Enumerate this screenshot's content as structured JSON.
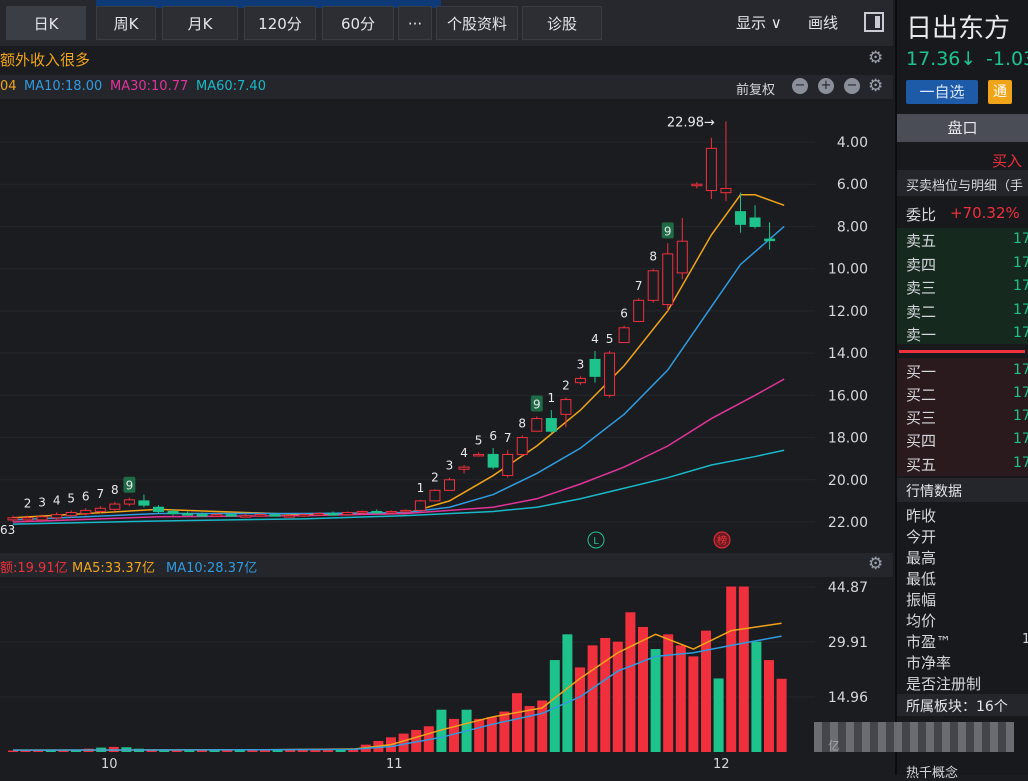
{
  "toolbar": {
    "tabs": [
      "日K",
      "周K",
      "月K",
      "120分",
      "60分"
    ],
    "more_label": "···",
    "profile_label": "个股资料",
    "diagnose_label": "诊股",
    "display_label": "显示 ∨",
    "draw_label": "画线"
  },
  "news_headline": "额外收入很多",
  "ma": {
    "ma5": "04",
    "ma10": "MA10:18.00",
    "ma30": "MA30:10.77",
    "ma60": "MA60:7.40",
    "adjust_label": "前复权",
    "color_ma5": "#f0a419",
    "color_ma10": "#2f9be0",
    "color_ma30": "#e0349a",
    "color_ma60": "#19b8c8"
  },
  "volume_header": {
    "amount": "额:19.91亿",
    "ma5": "MA5:33.37亿",
    "ma10": "MA10:28.37亿"
  },
  "price_axis": [
    "22.00",
    "20.00",
    "18.00",
    "16.00",
    "14.00",
    "12.00",
    "10.00",
    "8.00",
    "6.00",
    "4.00"
  ],
  "volume_axis": [
    "44.87",
    "29.91",
    "14.96"
  ],
  "volume_unit": "亿",
  "max_marker": "22.98→",
  "min_marker": "63",
  "date_labels": [
    "10",
    "11",
    "12"
  ],
  "markers": {
    "l": "L",
    "bang": "榜"
  },
  "stock": {
    "name": "日出东方",
    "price": "17.36↓",
    "change": "-1.03",
    "add_watch": "一自选",
    "tong": "通",
    "pankou": "盘口",
    "buy_in": "买入",
    "order_book_title": "买卖档位与明细（手",
    "weibi_label": "委比",
    "weibi_value": "+70.32%",
    "asks": [
      "卖五",
      "卖四",
      "卖三",
      "卖二",
      "卖一"
    ],
    "bids": [
      "买一",
      "买二",
      "买三",
      "买四",
      "买五"
    ],
    "level_value": "17",
    "market_title": "行情数据",
    "market_fields": [
      "昨收",
      "今开",
      "最高",
      "最低",
      "振幅",
      "均价",
      "市盈™",
      "市净率",
      "是否注册制"
    ],
    "pe_value": "1",
    "sector_label": "所属板块：16个",
    "bottom_cut": "热千概念"
  },
  "colors": {
    "up": "#f0303c",
    "down": "#1ec38b",
    "accent": "#f0a419",
    "watch": "#2f7fd9"
  },
  "chart_data": [
    {
      "type": "candlestick",
      "title": "日K",
      "ylim": [
        3.5,
        23.5
      ],
      "yticks": [
        4,
        6,
        8,
        10,
        12,
        14,
        16,
        18,
        20,
        22
      ],
      "max_label": 22.98,
      "candles": [
        {
          "o": 4.1,
          "c": 4.2,
          "h": 4.3,
          "l": 4.0
        },
        {
          "o": 4.1,
          "c": 4.2,
          "h": 4.3,
          "l": 4.0
        },
        {
          "o": 4.1,
          "c": 4.25,
          "h": 4.35,
          "l": 4.05
        },
        {
          "o": 4.2,
          "c": 4.35,
          "h": 4.45,
          "l": 4.1
        },
        {
          "o": 4.3,
          "c": 4.45,
          "h": 4.55,
          "l": 4.2
        },
        {
          "o": 4.4,
          "c": 4.55,
          "h": 4.65,
          "l": 4.3
        },
        {
          "o": 4.5,
          "c": 4.65,
          "h": 4.75,
          "l": 4.4
        },
        {
          "o": 4.6,
          "c": 4.85,
          "h": 4.95,
          "l": 4.5
        },
        {
          "o": 4.85,
          "c": 5.05,
          "h": 5.15,
          "l": 4.75
        },
        {
          "o": 5.0,
          "c": 4.8,
          "h": 5.3,
          "l": 4.7
        },
        {
          "o": 4.7,
          "c": 4.5,
          "h": 4.8,
          "l": 4.4
        },
        {
          "o": 4.5,
          "c": 4.4,
          "h": 4.6,
          "l": 4.3
        },
        {
          "o": 4.4,
          "c": 4.35,
          "h": 4.5,
          "l": 4.3
        },
        {
          "o": 4.35,
          "c": 4.3,
          "h": 4.45,
          "l": 4.25
        },
        {
          "o": 4.3,
          "c": 4.35,
          "h": 4.4,
          "l": 4.25
        },
        {
          "o": 4.35,
          "c": 4.3,
          "h": 4.4,
          "l": 4.25
        },
        {
          "o": 4.3,
          "c": 4.3,
          "h": 4.4,
          "l": 4.25
        },
        {
          "o": 4.3,
          "c": 4.35,
          "h": 4.4,
          "l": 4.25
        },
        {
          "o": 4.35,
          "c": 4.3,
          "h": 4.4,
          "l": 4.25
        },
        {
          "o": 4.3,
          "c": 4.3,
          "h": 4.35,
          "l": 4.25
        },
        {
          "o": 4.3,
          "c": 4.35,
          "h": 4.4,
          "l": 4.25
        },
        {
          "o": 4.35,
          "c": 4.4,
          "h": 4.45,
          "l": 4.3
        },
        {
          "o": 4.4,
          "c": 4.35,
          "h": 4.5,
          "l": 4.3
        },
        {
          "o": 4.35,
          "c": 4.45,
          "h": 4.5,
          "l": 4.3
        },
        {
          "o": 4.45,
          "c": 4.5,
          "h": 4.55,
          "l": 4.4
        },
        {
          "o": 4.5,
          "c": 4.45,
          "h": 4.6,
          "l": 4.4
        },
        {
          "o": 4.45,
          "c": 4.5,
          "h": 4.55,
          "l": 4.4
        },
        {
          "o": 4.5,
          "c": 4.55,
          "h": 4.6,
          "l": 4.45
        },
        {
          "o": 4.55,
          "c": 5.0,
          "h": 5.05,
          "l": 4.55
        },
        {
          "o": 5.0,
          "c": 5.5,
          "h": 5.55,
          "l": 5.0
        },
        {
          "o": 5.5,
          "c": 6.0,
          "h": 6.1,
          "l": 5.5
        },
        {
          "o": 6.5,
          "c": 6.6,
          "h": 6.7,
          "l": 6.3
        },
        {
          "o": 7.2,
          "c": 7.2,
          "h": 7.3,
          "l": 7.1
        },
        {
          "o": 7.2,
          "c": 6.6,
          "h": 7.5,
          "l": 6.5
        },
        {
          "o": 6.2,
          "c": 7.2,
          "h": 7.4,
          "l": 6.1
        },
        {
          "o": 7.2,
          "c": 8.0,
          "h": 8.1,
          "l": 7.1
        },
        {
          "o": 8.3,
          "c": 8.9,
          "h": 9.0,
          "l": 8.3
        },
        {
          "o": 8.9,
          "c": 8.3,
          "h": 9.3,
          "l": 8.2
        },
        {
          "o": 9.1,
          "c": 9.8,
          "h": 9.9,
          "l": 8.5
        },
        {
          "o": 10.6,
          "c": 10.8,
          "h": 10.9,
          "l": 10.5
        },
        {
          "o": 11.7,
          "c": 10.9,
          "h": 12.1,
          "l": 10.6
        },
        {
          "o": 10.0,
          "c": 12.0,
          "h": 12.1,
          "l": 9.9
        },
        {
          "o": 12.5,
          "c": 13.2,
          "h": 13.3,
          "l": 12.5
        },
        {
          "o": 13.5,
          "c": 14.5,
          "h": 14.6,
          "l": 13.5
        },
        {
          "o": 14.5,
          "c": 15.9,
          "h": 16.0,
          "l": 14.4
        },
        {
          "o": 14.3,
          "c": 16.7,
          "h": 17.2,
          "l": 14.0
        },
        {
          "o": 15.8,
          "c": 17.3,
          "h": 18.4,
          "l": 15.5
        },
        {
          "o": 20.0,
          "c": 20.0,
          "h": 20.1,
          "l": 19.8
        },
        {
          "o": 19.7,
          "c": 21.7,
          "h": 22.2,
          "l": 19.3
        },
        {
          "o": 19.6,
          "c": 19.8,
          "h": 22.98,
          "l": 19.2
        },
        {
          "o": 18.7,
          "c": 18.1,
          "h": 19.6,
          "l": 17.7
        },
        {
          "o": 18.4,
          "c": 18.0,
          "h": 19.0,
          "l": 17.9
        },
        {
          "o": 17.4,
          "c": 17.36,
          "h": 18.2,
          "l": 16.9
        }
      ],
      "td_counts": [
        {
          "i": 7,
          "n": "8"
        },
        {
          "i": 8,
          "n": "9"
        },
        {
          "i": 2,
          "n": "3"
        },
        {
          "i": 3,
          "n": "4"
        },
        {
          "i": 4,
          "n": "5"
        },
        {
          "i": 5,
          "n": "6"
        },
        {
          "i": 6,
          "n": "7"
        },
        {
          "i": 1,
          "n": "2"
        },
        {
          "i": 28,
          "n": "1"
        },
        {
          "i": 29,
          "n": "2"
        },
        {
          "i": 30,
          "n": "3"
        },
        {
          "i": 31,
          "n": "4"
        },
        {
          "i": 32,
          "n": "5"
        },
        {
          "i": 33,
          "n": "6"
        },
        {
          "i": 34,
          "n": "7"
        },
        {
          "i": 35,
          "n": "8"
        },
        {
          "i": 36,
          "n": "9"
        },
        {
          "i": 37,
          "n": "1"
        },
        {
          "i": 38,
          "n": "2"
        },
        {
          "i": 39,
          "n": "3"
        },
        {
          "i": 40,
          "n": "4"
        },
        {
          "i": 41,
          "n": "5"
        },
        {
          "i": 42,
          "n": "6"
        },
        {
          "i": 43,
          "n": "7"
        },
        {
          "i": 44,
          "n": "8"
        },
        {
          "i": 45,
          "n": "9"
        }
      ],
      "ma_series": [
        {
          "name": "MA5",
          "pts": [
            [
              0,
              4.2
            ],
            [
              10,
              4.6
            ],
            [
              20,
              4.35
            ],
            [
              27,
              4.4
            ],
            [
              30,
              5.0
            ],
            [
              33,
              6.2
            ],
            [
              36,
              7.6
            ],
            [
              39,
              9.3
            ],
            [
              42,
              11.4
            ],
            [
              45,
              14.0
            ],
            [
              48,
              17.6
            ],
            [
              50,
              19.5
            ],
            [
              51,
              19.5
            ],
            [
              53,
              19.0
            ]
          ]
        },
        {
          "name": "MA10",
          "pts": [
            [
              0,
              4.1
            ],
            [
              10,
              4.4
            ],
            [
              20,
              4.4
            ],
            [
              27,
              4.45
            ],
            [
              30,
              4.7
            ],
            [
              33,
              5.3
            ],
            [
              36,
              6.3
            ],
            [
              39,
              7.5
            ],
            [
              42,
              9.1
            ],
            [
              45,
              11.2
            ],
            [
              48,
              14.2
            ],
            [
              50,
              16.2
            ],
            [
              53,
              18.0
            ]
          ]
        },
        {
          "name": "MA30",
          "pts": [
            [
              0,
              4.0
            ],
            [
              10,
              4.25
            ],
            [
              20,
              4.3
            ],
            [
              27,
              4.4
            ],
            [
              33,
              4.7
            ],
            [
              36,
              5.1
            ],
            [
              39,
              5.8
            ],
            [
              42,
              6.6
            ],
            [
              45,
              7.6
            ],
            [
              48,
              8.9
            ],
            [
              51,
              10.0
            ],
            [
              53,
              10.77
            ]
          ]
        },
        {
          "name": "MA60",
          "pts": [
            [
              0,
              3.9
            ],
            [
              10,
              4.05
            ],
            [
              20,
              4.15
            ],
            [
              27,
              4.3
            ],
            [
              33,
              4.5
            ],
            [
              36,
              4.7
            ],
            [
              39,
              5.1
            ],
            [
              42,
              5.6
            ],
            [
              45,
              6.1
            ],
            [
              48,
              6.7
            ],
            [
              51,
              7.1
            ],
            [
              53,
              7.4
            ]
          ]
        }
      ]
    },
    {
      "type": "bar",
      "title": "成交额",
      "ylim": [
        0,
        47
      ],
      "yticks": [
        14.96,
        29.91,
        44.87
      ],
      "values": [
        0.4,
        0.4,
        0.4,
        0.5,
        0.5,
        0.6,
        0.9,
        1.2,
        1.4,
        1.3,
        0.9,
        0.7,
        0.6,
        0.6,
        0.5,
        0.5,
        0.5,
        0.5,
        0.5,
        0.5,
        0.5,
        0.6,
        0.6,
        0.6,
        0.7,
        0.7,
        0.8,
        0.9,
        2.0,
        3.0,
        4.0,
        5.0,
        6.0,
        7.0,
        11.5,
        9.0,
        11.5,
        9.0,
        9.5,
        11.0,
        16.0,
        12.5,
        14.0,
        25.0,
        32.0,
        23.0,
        29.0,
        31.0,
        30.0,
        38.0,
        34.0,
        28.0,
        32.0,
        29.0,
        26.0,
        33.0,
        20.0,
        45.0,
        45.0,
        30.0,
        25.0,
        19.91
      ],
      "up_flags": [
        1,
        1,
        1,
        0,
        1,
        0,
        1,
        0,
        1,
        0,
        0,
        1,
        0,
        1,
        0,
        1,
        0,
        1,
        0,
        1,
        1,
        0,
        1,
        1,
        1,
        1,
        0,
        1,
        1,
        1,
        1,
        1,
        1,
        1,
        0,
        1,
        0,
        1,
        1,
        1,
        1,
        1,
        1,
        0,
        0,
        1,
        1,
        1,
        1,
        1,
        1,
        0,
        1,
        1,
        1,
        1,
        0,
        1,
        1,
        0,
        1,
        1
      ],
      "ma_series": [
        {
          "name": "MA5",
          "pts": [
            [
              0,
              0.5
            ],
            [
              20,
              0.6
            ],
            [
              27,
              0.8
            ],
            [
              30,
              2.0
            ],
            [
              34,
              6.0
            ],
            [
              38,
              9.5
            ],
            [
              42,
              12.0
            ],
            [
              45,
              20.0
            ],
            [
              48,
              27.0
            ],
            [
              51,
              32.0
            ],
            [
              54,
              28.0
            ],
            [
              57,
              33.0
            ],
            [
              61,
              35.0
            ]
          ]
        },
        {
          "name": "MA10",
          "pts": [
            [
              0,
              0.5
            ],
            [
              20,
              0.6
            ],
            [
              27,
              0.7
            ],
            [
              30,
              1.5
            ],
            [
              34,
              4.0
            ],
            [
              38,
              7.5
            ],
            [
              42,
              10.5
            ],
            [
              45,
              15.0
            ],
            [
              48,
              22.0
            ],
            [
              51,
              26.0
            ],
            [
              54,
              27.0
            ],
            [
              57,
              29.0
            ],
            [
              61,
              31.5
            ]
          ]
        }
      ]
    }
  ]
}
